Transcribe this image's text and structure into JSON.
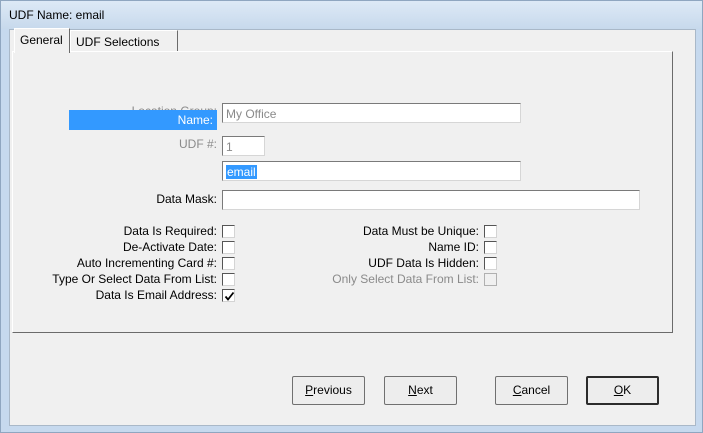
{
  "window": {
    "title": "UDF Name: email"
  },
  "tabs": [
    {
      "label": "General",
      "active": true
    },
    {
      "label": "UDF Selections",
      "active": false
    }
  ],
  "form": {
    "location_group": {
      "label": "Location Group:",
      "value": "My Office"
    },
    "udf_number": {
      "label": "UDF #:",
      "value": "1"
    },
    "name": {
      "label": "Name:",
      "value": "email"
    },
    "data_mask": {
      "label": "Data Mask:",
      "value": ""
    }
  },
  "checkboxes_left": [
    {
      "label": "Data Is Required:",
      "checked": false
    },
    {
      "label": "De-Activate Date:",
      "checked": false
    },
    {
      "label": "Auto Incrementing Card #:",
      "checked": false
    },
    {
      "label": "Type Or Select Data From List:",
      "checked": false
    },
    {
      "label": "Data Is Email Address:",
      "checked": true
    }
  ],
  "checkboxes_right": [
    {
      "label": "Data Must be Unique:",
      "checked": false,
      "enabled": true
    },
    {
      "label": "Name ID:",
      "checked": false,
      "enabled": true
    },
    {
      "label": "UDF Data Is Hidden:",
      "checked": false,
      "enabled": true
    },
    {
      "label": "Only Select Data From List:",
      "checked": false,
      "enabled": false
    }
  ],
  "buttons": {
    "previous": {
      "mnemonic": "P",
      "rest": "revious"
    },
    "next": {
      "mnemonic": "N",
      "rest": "ext"
    },
    "cancel": {
      "mnemonic": "C",
      "rest": "ancel"
    },
    "ok": {
      "mnemonic": "O",
      "rest": "K"
    }
  },
  "colors": {
    "selection": "#3399ff",
    "titlebar": "#c7d9ec",
    "dialog": "#f0f0f0"
  }
}
